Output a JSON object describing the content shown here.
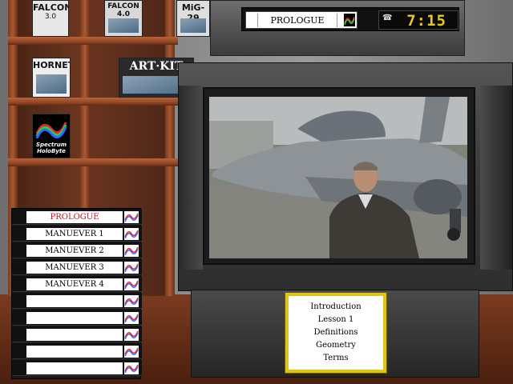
{
  "vcr": {
    "tape_label": "PROLOGUE",
    "clock_time": "7:15",
    "phone_icon": "phone-icon"
  },
  "shelf_boxes": [
    {
      "title": "FALCON",
      "subtitle": "3.0",
      "color": "#e7e7e7"
    },
    {
      "title": "FALCON 4.0",
      "subtitle": "",
      "color": "#d8d8d8"
    },
    {
      "title": "MiG-29",
      "subtitle": "",
      "color": "#dedede"
    },
    {
      "title": "HORNET",
      "subtitle": "",
      "color": "#eeeeee"
    },
    {
      "title": "ART·KIT",
      "subtitle": "",
      "color": "#2a2a2a"
    },
    {
      "title": "Spectrum HoloByte",
      "subtitle": "",
      "color": "#000000"
    }
  ],
  "tape_stack": [
    {
      "label": "PROLOGUE",
      "active": true
    },
    {
      "label": "MANUEVER 1",
      "active": false
    },
    {
      "label": "MANUEVER 2",
      "active": false
    },
    {
      "label": "MANUEVER 3",
      "active": false
    },
    {
      "label": "MANUEVER 4",
      "active": false
    },
    {
      "label": "",
      "active": false
    },
    {
      "label": "",
      "active": false
    },
    {
      "label": "",
      "active": false
    },
    {
      "label": "",
      "active": false
    },
    {
      "label": "",
      "active": false
    }
  ],
  "menu": {
    "items": [
      "Introduction",
      "Lesson 1",
      "Definitions",
      "Geometry",
      "Terms"
    ]
  },
  "colors": {
    "menu_border": "#e2c414",
    "active_tape_text": "#c0141c",
    "clock_digits": "#e6c81e"
  }
}
